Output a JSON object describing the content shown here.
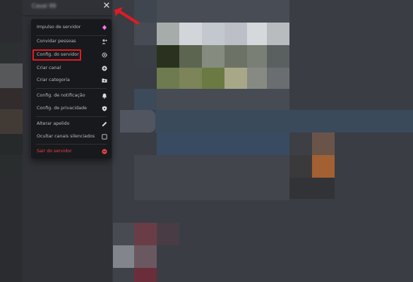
{
  "server_header": {
    "name": "Casal 99"
  },
  "menu": {
    "items": [
      {
        "label": "Impulso de servidor",
        "icon": "boost-icon"
      },
      {
        "label": "Convidar pessoas",
        "icon": "add-user-icon"
      },
      {
        "label": "Config. do servidor",
        "icon": "gear-icon"
      },
      {
        "label": "Criar canal",
        "icon": "plus-circle-icon"
      },
      {
        "label": "Criar categoria",
        "icon": "folder-plus-icon"
      },
      {
        "label": "Config. de notificação",
        "icon": "bell-icon"
      },
      {
        "label": "Config. de privacidade",
        "icon": "shield-icon"
      },
      {
        "label": "Alterar apelido",
        "icon": "pencil-icon"
      },
      {
        "label": "Ocultar canais silenciados",
        "icon": "checkbox-icon"
      },
      {
        "label": "Sair do servidor",
        "icon": "leave-icon"
      }
    ]
  },
  "annotation": {
    "highlighted_item": "Config. do servidor"
  },
  "colors": {
    "menu_bg": "#18191c",
    "text": "#b9bbbe",
    "danger": "#ed4245",
    "boost": "#ff73fa",
    "annotation_red": "#e01b22"
  }
}
